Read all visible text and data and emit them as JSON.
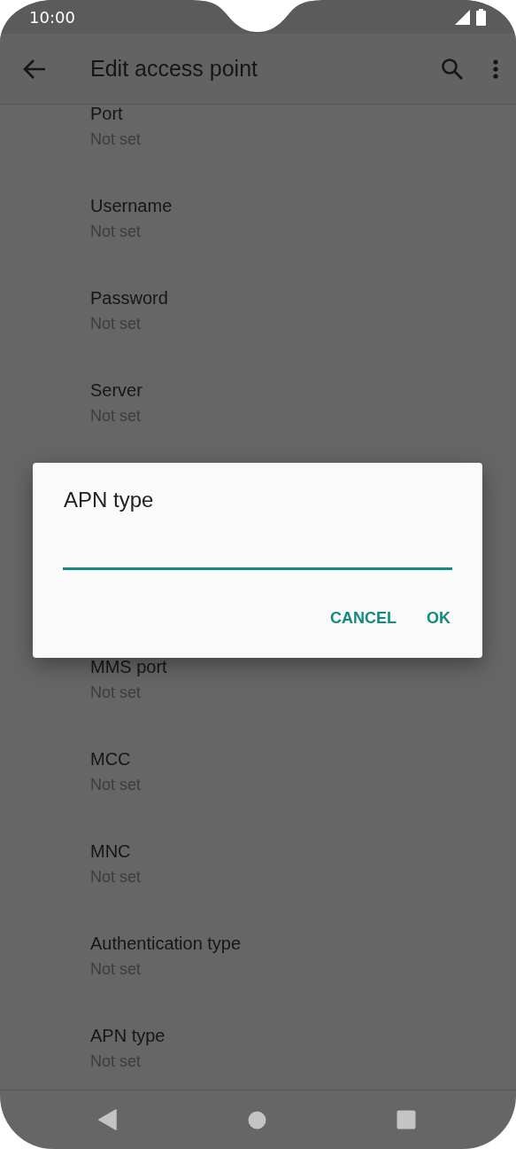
{
  "status_bar": {
    "time": "10:00"
  },
  "app_bar": {
    "title": "Edit access point"
  },
  "list_above": [
    {
      "title": "Port",
      "summary": "Not set"
    },
    {
      "title": "Username",
      "summary": "Not set"
    },
    {
      "title": "Password",
      "summary": "Not set"
    },
    {
      "title": "Server",
      "summary": "Not set"
    }
  ],
  "list_below": [
    {
      "title": "MMS port",
      "summary": "Not set"
    },
    {
      "title": "MCC",
      "summary": "Not set"
    },
    {
      "title": "MNC",
      "summary": "Not set"
    },
    {
      "title": "Authentication type",
      "summary": "Not set"
    },
    {
      "title": "APN type",
      "summary": "Not set"
    }
  ],
  "dialog": {
    "title": "APN type",
    "buttons": [
      "CANCEL",
      "OK"
    ]
  }
}
